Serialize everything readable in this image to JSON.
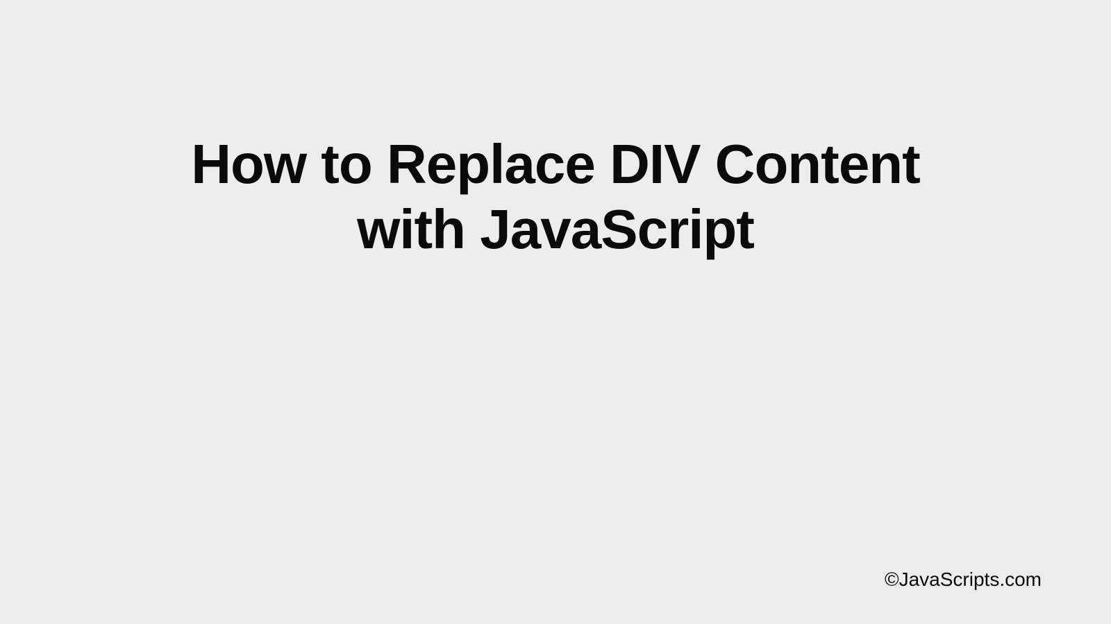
{
  "title_line1": "How to Replace DIV Content",
  "title_line2": "with JavaScript",
  "footer_text": "©JavaScripts.com"
}
